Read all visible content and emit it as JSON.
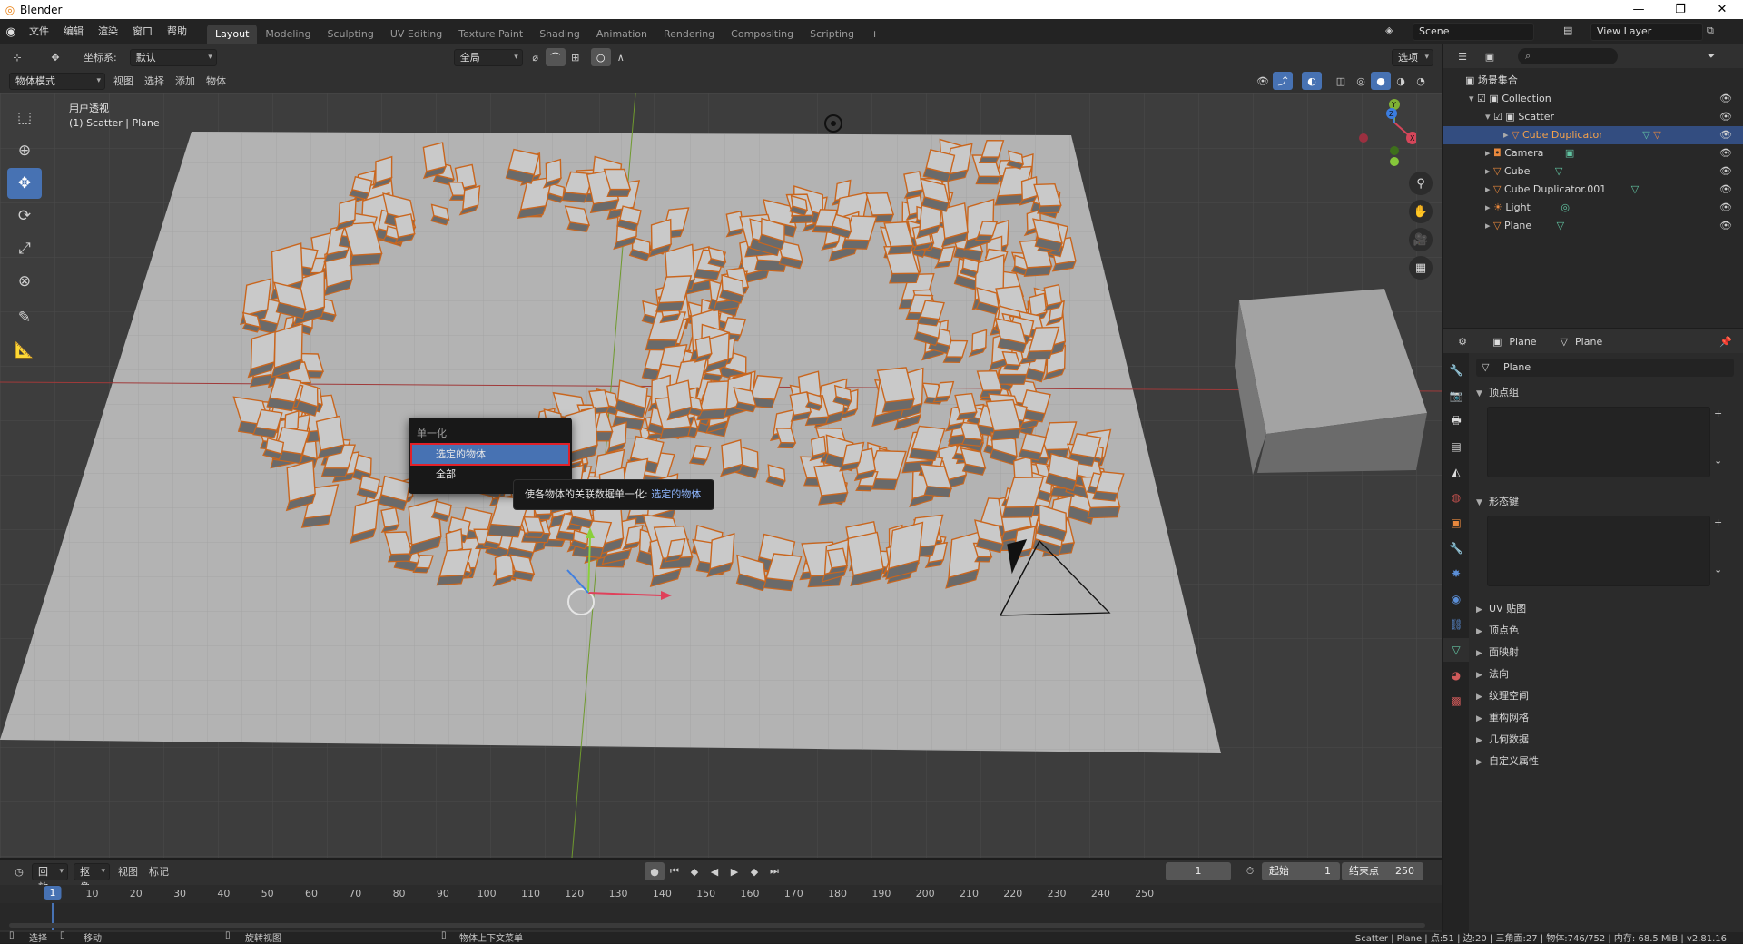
{
  "window": {
    "title": "Blender",
    "minimize": "—",
    "maximize": "❐",
    "close": "✕"
  },
  "menu": [
    "文件",
    "编辑",
    "渲染",
    "窗口",
    "帮助"
  ],
  "workspaces": [
    "Layout",
    "Modeling",
    "Sculpting",
    "UV Editing",
    "Texture Paint",
    "Shading",
    "Animation",
    "Rendering",
    "Compositing",
    "Scripting"
  ],
  "workspace_add": "+",
  "scene": "Scene",
  "view_layer": "View Layer",
  "viewport_header": {
    "coord_label": "坐标系:",
    "coord_value": "默认",
    "pivot_value": "全局",
    "options": "选项",
    "mode": "物体模式",
    "menus": [
      "视图",
      "选择",
      "添加",
      "物体"
    ]
  },
  "viewport": {
    "view_name": "用户透视",
    "object_info": "(1) Scatter | Plane",
    "axis_x": "X",
    "axis_y": "Y",
    "axis_z": "Z"
  },
  "popup": {
    "title": "单一化",
    "items": [
      "选定的物体",
      "全部"
    ],
    "tooltip_text": "使各物体的关联数据单一化: ",
    "tooltip_value": "选定的物体"
  },
  "outliner": {
    "root": "场景集合",
    "rows": [
      {
        "name": "Collection"
      },
      {
        "name": "Scatter"
      },
      {
        "name": "Cube Duplicator",
        "selected": true
      },
      {
        "name": "Camera"
      },
      {
        "name": "Cube"
      },
      {
        "name": "Cube Duplicator.001"
      },
      {
        "name": "Light"
      },
      {
        "name": "Plane"
      }
    ]
  },
  "properties": {
    "breadcrumb_object": "Plane",
    "breadcrumb_data": "Plane",
    "data_name": "Plane",
    "sections": [
      "顶点组",
      "形态键",
      "UV 贴图",
      "顶点色",
      "面映射",
      "法向",
      "纹理空间",
      "重构网格",
      "几何数据",
      "自定义属性"
    ]
  },
  "timeline": {
    "menus": [
      "回放",
      "抠像",
      "视图",
      "标记"
    ],
    "current_frame": "1",
    "start_label": "起始",
    "start_value": "1",
    "end_label": "结束点",
    "end_value": "250",
    "ruler": [
      "1",
      "10",
      "20",
      "30",
      "40",
      "50",
      "60",
      "70",
      "80",
      "90",
      "100",
      "110",
      "120",
      "130",
      "140",
      "150",
      "160",
      "170",
      "180",
      "190",
      "200",
      "210",
      "220",
      "230",
      "240",
      "250"
    ]
  },
  "statusbar": {
    "select": "选择",
    "move": "移动",
    "rotate": "旋转视图",
    "context": "物体上下文菜单",
    "stats": "Scatter | Plane | 点:51 | 边:20 | 三角面:27 | 物体:746/752 | 内存: 68.5 MiB | v2.81.16"
  },
  "colors": {
    "accent": "#4772b3",
    "selection": "#e8883d",
    "highlight_border": "#e12129"
  }
}
